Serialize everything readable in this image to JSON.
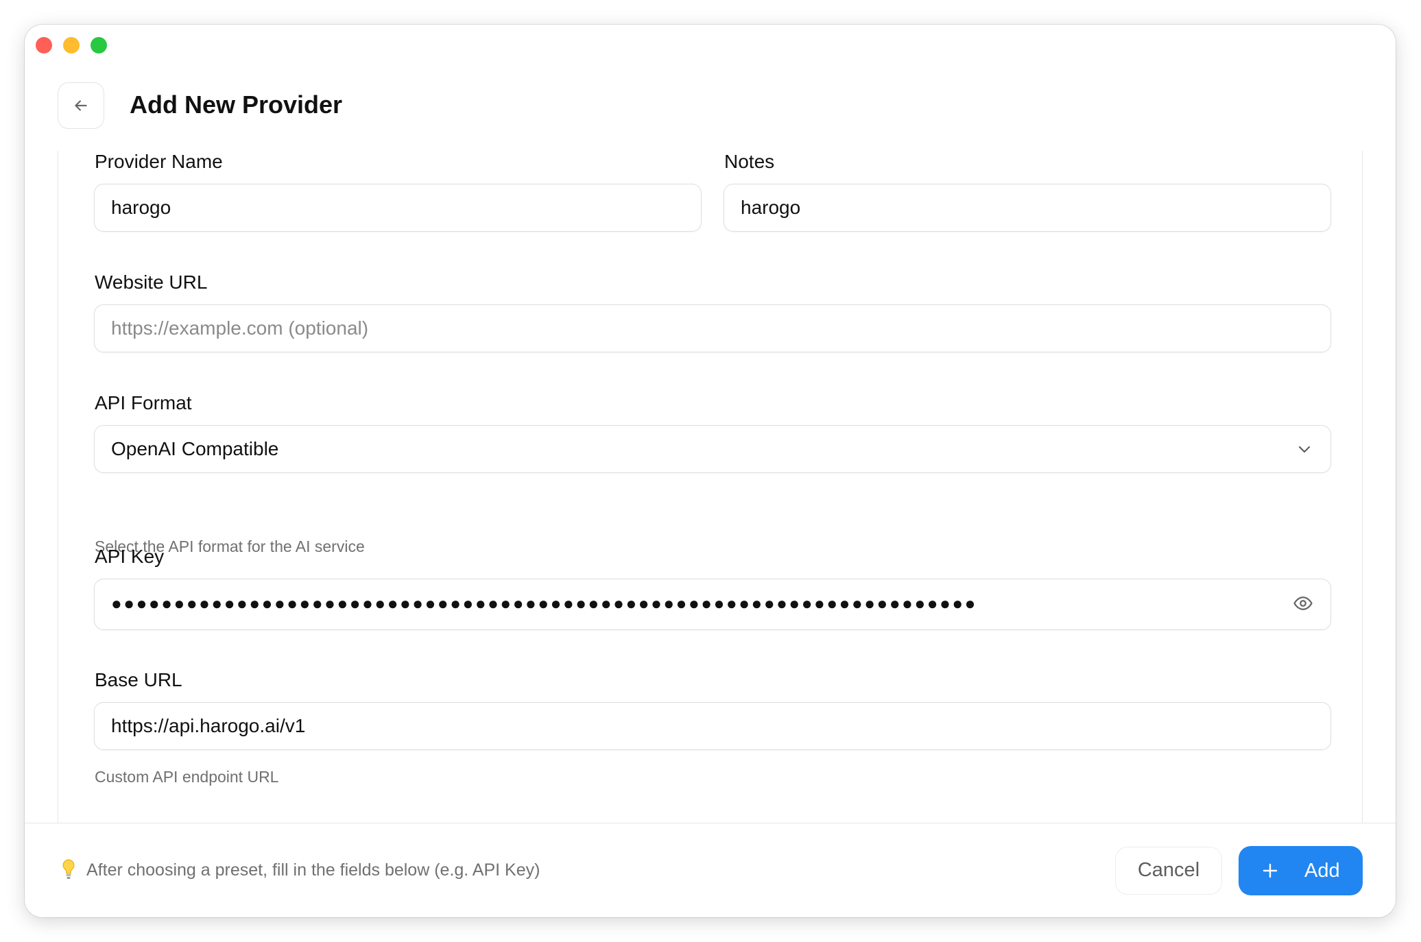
{
  "header": {
    "title": "Add New Provider",
    "back_icon": "arrow-left-icon"
  },
  "form": {
    "provider_name": {
      "label": "Provider Name",
      "value": "harogo",
      "placeholder": ""
    },
    "notes": {
      "label": "Notes",
      "value": "harogo",
      "placeholder": ""
    },
    "website_url": {
      "label": "Website URL",
      "value": "",
      "placeholder": "https://example.com (optional)"
    },
    "api_format": {
      "label": "API Format",
      "selected": "OpenAI Compatible",
      "hint": "Select the API format for the AI service"
    },
    "api_key": {
      "label": "API Key",
      "masked_value": "●●●●●●●●●●●●●●●●●●●●●●●●●●●●●●●●●●●●●●●●●●●●●●●●●●●●●●●●●●●●●●●●●●●●●",
      "visibility_icon": "eye-icon"
    },
    "base_url": {
      "label": "Base URL",
      "value": "https://api.harogo.ai/v1",
      "hint": "Custom API endpoint URL"
    }
  },
  "footer": {
    "tip": "After choosing a preset, fill in the fields below (e.g. API Key)",
    "tip_icon": "lightbulb-icon",
    "cancel_label": "Cancel",
    "add_label": "Add"
  },
  "colors": {
    "accent": "#2186f2",
    "traffic_close": "#fe5f57",
    "traffic_minimize": "#febc2e",
    "traffic_maximize": "#28c840"
  }
}
